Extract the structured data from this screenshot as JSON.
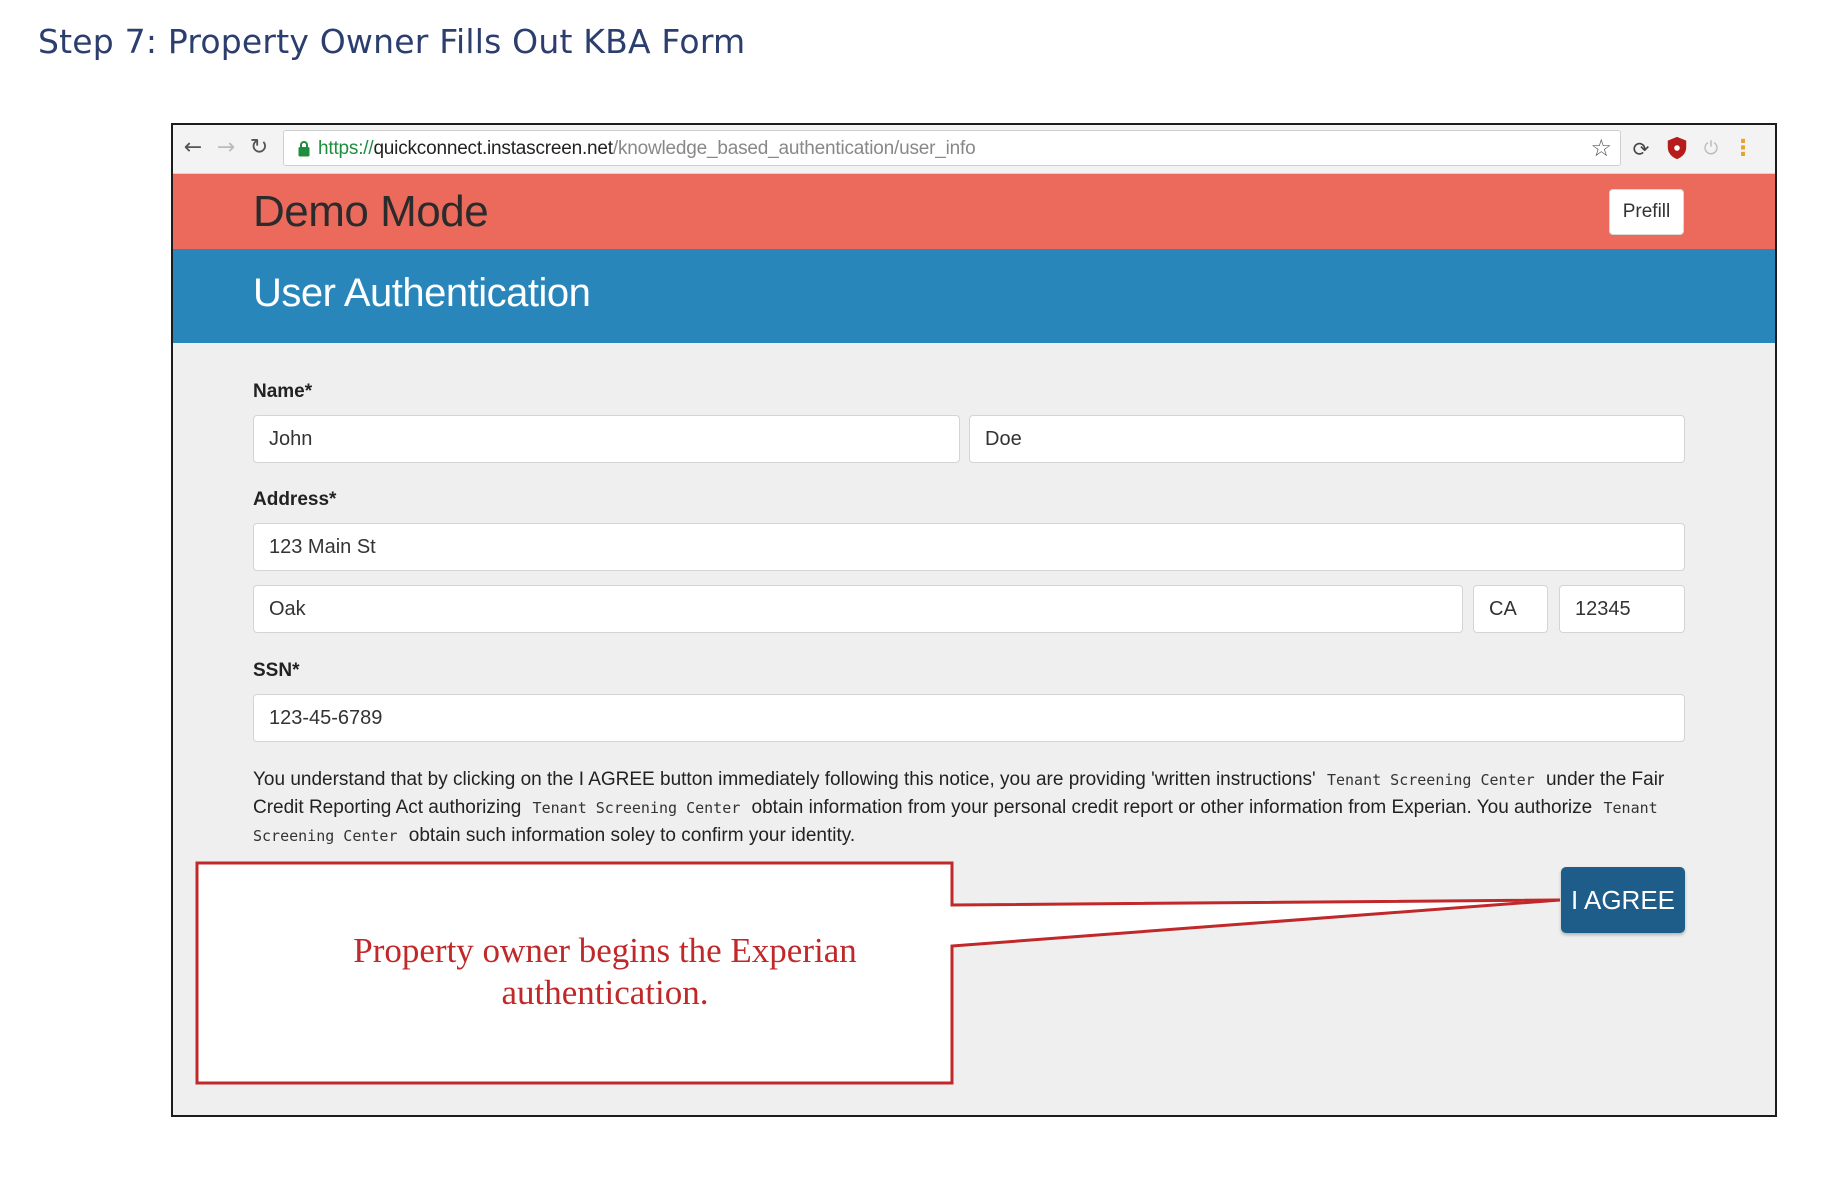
{
  "step_title": "Step 7: Property Owner Fills Out KBA Form",
  "browser": {
    "url_scheme": "https://",
    "url_host": "quickconnect.instascreen.net",
    "url_path": "/knowledge_based_authentication/user_info"
  },
  "demo_bar": {
    "title": "Demo Mode",
    "prefill_label": "Prefill",
    "color": "#ec6a5c"
  },
  "auth_bar": {
    "title": "User Authentication",
    "color": "#2986bb"
  },
  "form": {
    "name_label": "Name*",
    "first_name": "John",
    "last_name": "Doe",
    "address_label": "Address*",
    "street": "123 Main St",
    "city": "Oak",
    "state": "CA",
    "zip": "12345",
    "ssn_label": "SSN*",
    "ssn": "123-45-6789"
  },
  "notice": {
    "part1": "You understand that by clicking on the I AGREE button immediately following this notice, you are providing 'written instructions'",
    "company_1": "Tenant Screening Center",
    "part2": "under the Fair Credit Reporting Act authorizing",
    "company_2": "Tenant Screening Center",
    "part3": "obtain information from your personal credit report or other information from Experian. You authorize",
    "company_3": "Tenant Screening Center",
    "part4": "obtain such information soley to confirm your identity."
  },
  "agree_label": "I AGREE",
  "agree_color": "#1e5c8a",
  "callout": {
    "line1": "Property owner begins the Experian",
    "line2": "authentication.",
    "color": "#c0282a"
  }
}
